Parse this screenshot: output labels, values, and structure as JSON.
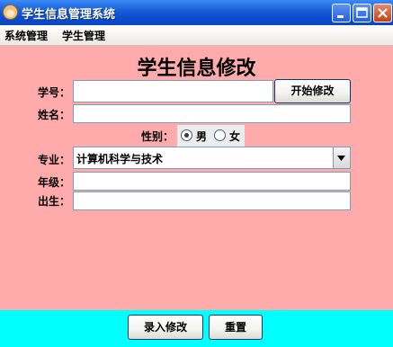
{
  "window": {
    "title": "学生信息管理系统",
    "app_icon": "student-face-icon"
  },
  "menu": {
    "items": [
      "系统管理",
      "学生管理"
    ]
  },
  "form": {
    "title": "学生信息修改",
    "student_id": {
      "label": "学号：",
      "value": ""
    },
    "start_edit_button": "开始修改",
    "name": {
      "label": "姓名：",
      "value": ""
    },
    "gender": {
      "label": "性别：",
      "options": [
        "男",
        "女"
      ],
      "selected": "男"
    },
    "major": {
      "label": "专业：",
      "selected": "计算机科学与技术"
    },
    "grade": {
      "label": "年级：",
      "value": ""
    },
    "birth": {
      "label": "出生：",
      "value": ""
    }
  },
  "actions": {
    "submit": "录入修改",
    "reset": "重置"
  },
  "colors": {
    "content_bg": "#ffabab",
    "bottom_bg": "#00ffff",
    "titlebar": "#0b4ccf"
  }
}
